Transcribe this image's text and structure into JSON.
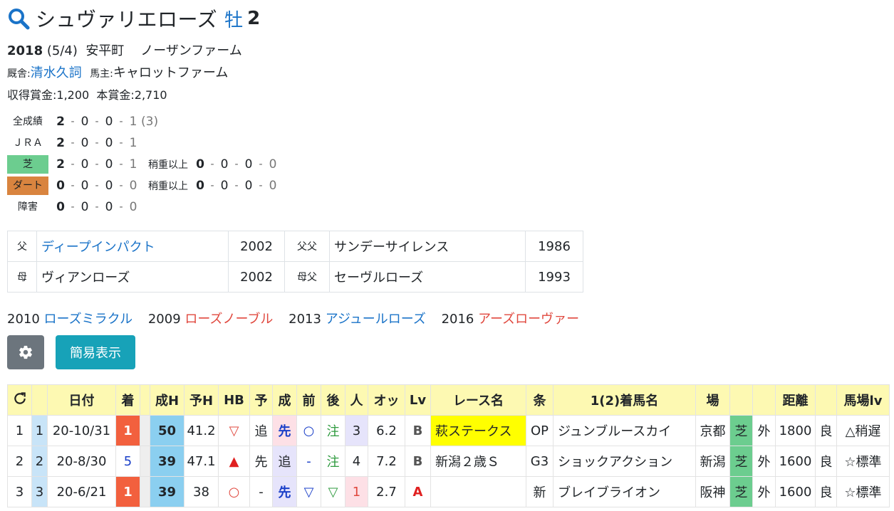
{
  "horse": {
    "name": "シュヴァリエローズ",
    "sex": "牡",
    "age": "2",
    "birth_year": "2018",
    "birth_date": "(5/4)",
    "birthplace": "安平町",
    "breeder": "ノーザンファーム",
    "stable_label": "厩舎:",
    "trainer": "清水久詞",
    "owner_label": "馬主:",
    "owner": "キャロットファーム",
    "prize_line": "収得賞金:1,200",
    "main_prize_line": "本賞金:2,710"
  },
  "record": {
    "all": {
      "label": "全成績",
      "v": [
        "2",
        "0",
        "0",
        "1"
      ],
      "extra": "(3)"
    },
    "jra": {
      "label": "ＪＲＡ",
      "v": [
        "2",
        "0",
        "0",
        "1"
      ]
    },
    "turf": {
      "label": "芝",
      "v": [
        "2",
        "0",
        "0",
        "1"
      ],
      "sub_label": "稍重以上",
      "sub": [
        "0",
        "0",
        "0",
        "0"
      ]
    },
    "dirt": {
      "label": "ダート",
      "v": [
        "0",
        "0",
        "0",
        "0"
      ],
      "sub_label": "稍重以上",
      "sub": [
        "0",
        "0",
        "0",
        "0"
      ]
    },
    "jump": {
      "label": "障害",
      "v": [
        "0",
        "0",
        "0",
        "0"
      ]
    },
    "sep": "-"
  },
  "pedigree": {
    "sire_label": "父",
    "sire": "ディープインパクト",
    "sire_year": "2002",
    "sire_sire_label": "父父",
    "sire_sire": "サンデーサイレンス",
    "sire_sire_year": "1986",
    "dam_label": "母",
    "dam": "ヴィアンローズ",
    "dam_year": "2002",
    "dam_sire_label": "母父",
    "dam_sire": "セーヴルローズ",
    "dam_sire_year": "1993"
  },
  "siblings": [
    {
      "year": "2010",
      "name": "ローズミラクル",
      "color": "blue"
    },
    {
      "year": "2009",
      "name": "ローズノーブル",
      "color": "red"
    },
    {
      "year": "2013",
      "name": "アジュールローズ",
      "color": "blue"
    },
    {
      "year": "2016",
      "name": "アーズローヴァー",
      "color": "red"
    }
  ],
  "buttons": {
    "gear_icon": "gear-icon",
    "simple_label": "簡易表示"
  },
  "table": {
    "headers": [
      "",
      "",
      "日付",
      "着",
      "",
      "成H",
      "予H",
      "HB",
      "予",
      "成",
      "前",
      "後",
      "人",
      "オッ",
      "Lv",
      "レース名",
      "条",
      "1(2)着馬名",
      "場",
      "",
      "",
      "距離",
      "",
      "馬場lv"
    ],
    "refresh_icon": "refresh-icon",
    "rows": [
      {
        "no": "1",
        "n2": "1",
        "date": "20-10/31",
        "finish": "1",
        "h1": "50",
        "h2": "41.2",
        "hb": "▽",
        "pred": "追",
        "act": "先",
        "front": "○",
        "back": "注",
        "pop": "3",
        "odds": "6.2",
        "lv": "B",
        "race": "萩ステークス",
        "cond": "OP",
        "winner": "ジュンブルースカイ",
        "course": "京都",
        "surface": "芝",
        "inout": "外",
        "dist": "1800",
        "going": "良",
        "trackLv": "△稍遅"
      },
      {
        "no": "2",
        "n2": "2",
        "date": "20-8/30",
        "finish": "5",
        "h1": "39",
        "h2": "47.1",
        "hb": "▲",
        "pred": "先",
        "act": "追",
        "front": "-",
        "back": "注",
        "pop": "4",
        "odds": "7.2",
        "lv": "B",
        "race": "新潟２歳Ｓ",
        "cond": "G3",
        "winner": "ショックアクション",
        "course": "新潟",
        "surface": "芝",
        "inout": "外",
        "dist": "1600",
        "going": "良",
        "trackLv": "☆標準"
      },
      {
        "no": "3",
        "n2": "3",
        "date": "20-6/21",
        "finish": "1",
        "h1": "39",
        "h2": "38",
        "hb": "○",
        "pred": "-",
        "act": "先",
        "front": "▽",
        "back": "▽",
        "pop": "1",
        "odds": "2.7",
        "lv": "A",
        "race": "",
        "cond": "新",
        "winner": "ブレイブライオン",
        "course": "阪神",
        "surface": "芝",
        "inout": "外",
        "dist": "1600",
        "going": "良",
        "trackLv": "☆標準"
      }
    ]
  }
}
